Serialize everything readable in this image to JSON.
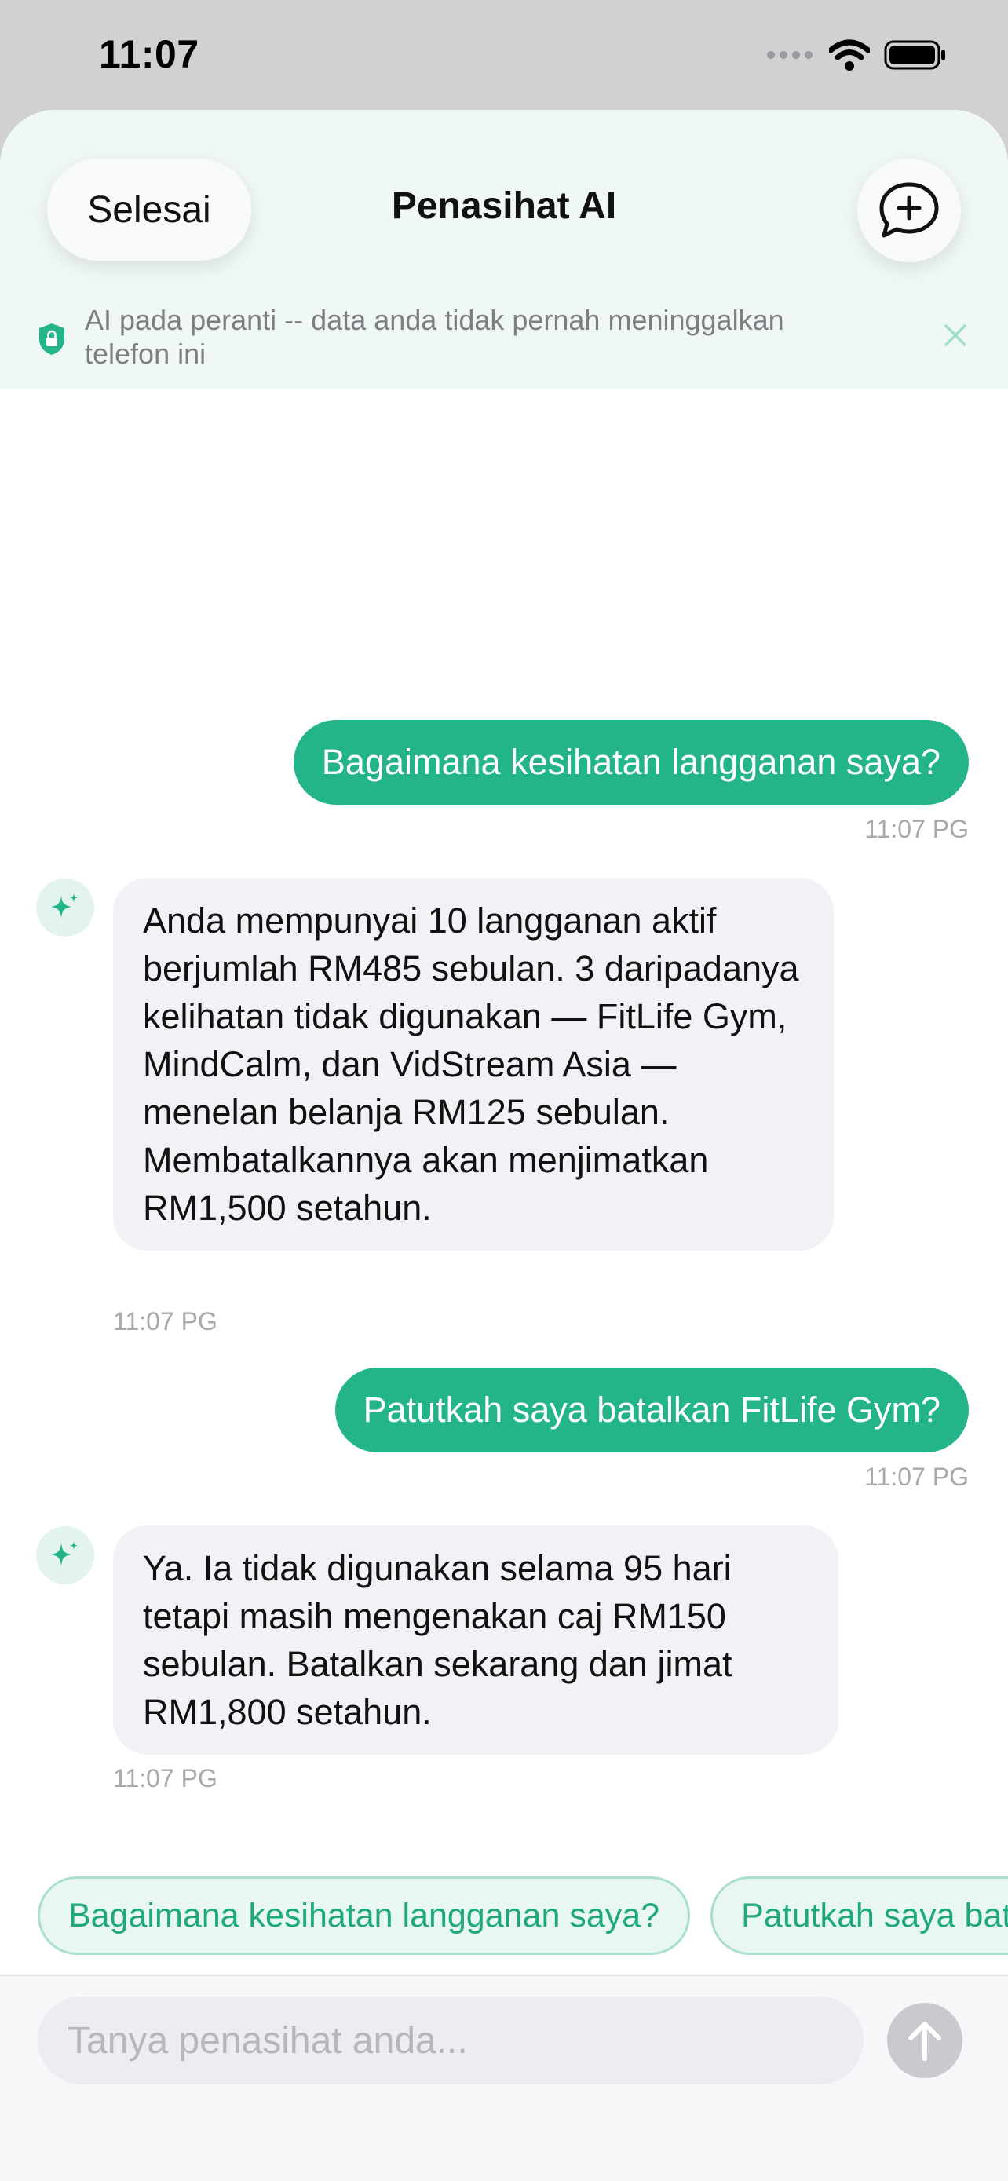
{
  "status_bar": {
    "time": "11:07"
  },
  "header": {
    "done_label": "Selesai",
    "title": "Penasihat AI",
    "new_chat_icon": "plus-bubble-icon"
  },
  "privacy_banner": {
    "text": "AI pada peranti -- data anda tidak pernah meninggalkan telefon ini",
    "icon": "lock-shield-icon"
  },
  "messages": [
    {
      "role": "user",
      "text": "Bagaimana kesihatan langganan saya?",
      "time": "11:07 PG"
    },
    {
      "role": "assistant",
      "text": "Anda mempunyai 10 langganan aktif berjumlah RM485 sebulan. 3 daripadanya kelihatan tidak digunakan — FitLife Gym, MindCalm, dan VidStream Asia — menelan belanja RM125 sebulan. Membatalkannya akan menjimatkan RM1,500 setahun.",
      "time": "11:07 PG"
    },
    {
      "role": "user",
      "text": "Patutkah saya batalkan FitLife Gym?",
      "time": "11:07 PG"
    },
    {
      "role": "assistant",
      "text": "Ya. Ia tidak digunakan selama 95 hari tetapi masih mengenakan caj RM150 sebulan. Batalkan sekarang dan jimat RM1,800 setahun.",
      "time": "11:07 PG"
    }
  ],
  "suggestions": [
    "Bagaimana kesihatan langganan saya?",
    "Patutkah saya batalkan FitLife Gym?"
  ],
  "composer": {
    "placeholder": "Tanya penasihat anda..."
  },
  "colors": {
    "accent": "#23b589",
    "header_bg": "#f0f8f6",
    "ai_bubble": "#f1f1f6"
  }
}
